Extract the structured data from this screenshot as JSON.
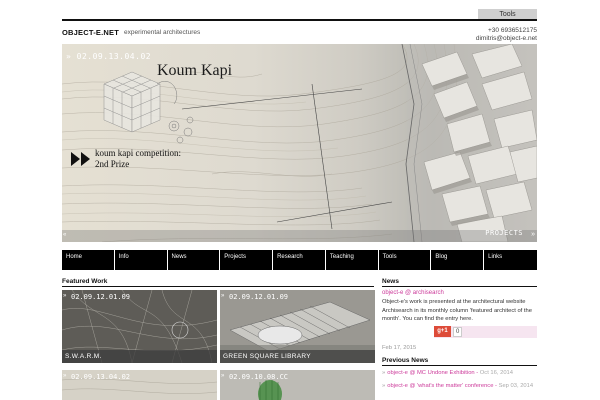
{
  "header": {
    "tools_tab": "Tools",
    "site_title": "OBJECT-E.NET",
    "tagline": "experimental architectures",
    "phone": "+30 6936512175",
    "email": "dimitris@object-e.net"
  },
  "hero": {
    "date": "02.09.13.04.02",
    "title": "Koum Kapi",
    "caption_line1": "koum kapi competition:",
    "caption_line2": "2nd Prize",
    "projects_label": "PROJECTS"
  },
  "nav": {
    "items": [
      "Home",
      "Info",
      "News",
      "Projects",
      "Research",
      "Teaching",
      "Tools",
      "Blog",
      "Links"
    ]
  },
  "featured": {
    "heading": "Featured Work",
    "cards": [
      {
        "date": "02.09.12.01.09",
        "label": "S.W.A.R.M."
      },
      {
        "date": "02.09.12.01.09",
        "label": "GREEN SQUARE LIBRARY"
      },
      {
        "date": "02.09.13.04.02",
        "label": ""
      },
      {
        "date": "02.09.10.08.CC",
        "label": ""
      }
    ]
  },
  "news": {
    "heading": "News",
    "link": "object-e @ archisearch",
    "body": "Object-e's work is presented at the architectural website Archisearch in its monthly column 'featured architect of the month'. You can find the entry here.",
    "gplus_label": "g+1",
    "gplus_count": "0",
    "date": "Feb 17, 2015"
  },
  "previous": {
    "heading": "Previous News",
    "items": [
      {
        "text": "object-e @ MC Undone Exhibition",
        "date": "Oct 16, 2014"
      },
      {
        "text": "object-e @ 'what's the matter' conference",
        "date": "Sep 03, 2014"
      }
    ]
  },
  "colors": {
    "accent_pink": "#cc3a9a",
    "nav_bg": "#000000"
  }
}
